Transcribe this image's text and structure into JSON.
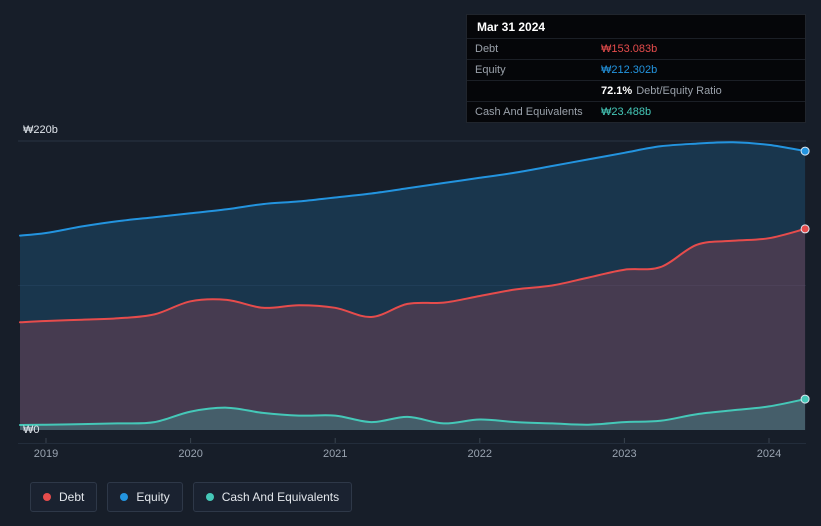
{
  "tooltip": {
    "date": "Mar 31 2024",
    "debt_label": "Debt",
    "debt_value": "₩153.083b",
    "equity_label": "Equity",
    "equity_value": "₩212.302b",
    "ratio_value": "72.1%",
    "ratio_label": "Debt/Equity Ratio",
    "cash_label": "Cash And Equivalents",
    "cash_value": "₩23.488b"
  },
  "axes": {
    "y_top_label": "₩220b",
    "y_zero_label": "₩0"
  },
  "legend": {
    "debt": "Debt",
    "equity": "Equity",
    "cash": "Cash And Equivalents"
  },
  "colors": {
    "debt": "#e64c4c",
    "equity": "#2394df",
    "cash": "#45c8b8",
    "background": "#171e29"
  },
  "chart_data": {
    "type": "area",
    "xlabel": "",
    "ylabel": "",
    "ylim": [
      0,
      220
    ],
    "y_gridlines": [
      220,
      110
    ],
    "y_axis_labels": {
      "top": "₩220b",
      "bottom": "₩0"
    },
    "x": [
      2018.82,
      2019,
      2019.25,
      2019.5,
      2019.75,
      2020,
      2020.25,
      2020.5,
      2020.75,
      2021,
      2021.25,
      2021.5,
      2021.75,
      2022,
      2022.25,
      2022.5,
      2022.75,
      2023,
      2023.25,
      2023.5,
      2023.75,
      2024,
      2024.25
    ],
    "x_ticks": [
      {
        "year": 2019,
        "label": "2019"
      },
      {
        "year": 2020,
        "label": "2020"
      },
      {
        "year": 2021,
        "label": "2021"
      },
      {
        "year": 2022,
        "label": "2022"
      },
      {
        "year": 2023,
        "label": "2023"
      },
      {
        "year": 2024,
        "label": "2024"
      }
    ],
    "series": [
      {
        "key": "equity",
        "name": "Equity",
        "color": "#2394df",
        "fill": "rgba(35,148,223,0.20)",
        "values": [
          148,
          150,
          155,
          159,
          162,
          165,
          168,
          172,
          174,
          177,
          180,
          184,
          188,
          192,
          196,
          201,
          206,
          211,
          216,
          218,
          219,
          217,
          212.302
        ]
      },
      {
        "key": "debt",
        "name": "Debt",
        "color": "#e64c4c",
        "fill": "rgba(230,76,92,0.22)",
        "values": [
          82,
          83,
          84,
          85,
          88,
          98,
          99,
          93,
          95,
          93,
          86,
          96,
          97,
          102,
          107,
          110,
          116,
          122,
          124,
          141,
          144,
          146,
          153.083
        ]
      },
      {
        "key": "cash",
        "name": "Cash And Equivalents",
        "color": "#45c8b8",
        "fill": "rgba(69,200,184,0.25)",
        "values": [
          3.8,
          4,
          4.5,
          5,
          6,
          14,
          17,
          13,
          11,
          11,
          6,
          10,
          5,
          8,
          6,
          5,
          4,
          6,
          7,
          12,
          15,
          18,
          23.488
        ]
      }
    ],
    "latest": {
      "date": "Mar 31 2024",
      "debt": 153.083,
      "equity": 212.302,
      "debt_equity_ratio_pct": 72.1,
      "cash": 23.488
    }
  }
}
